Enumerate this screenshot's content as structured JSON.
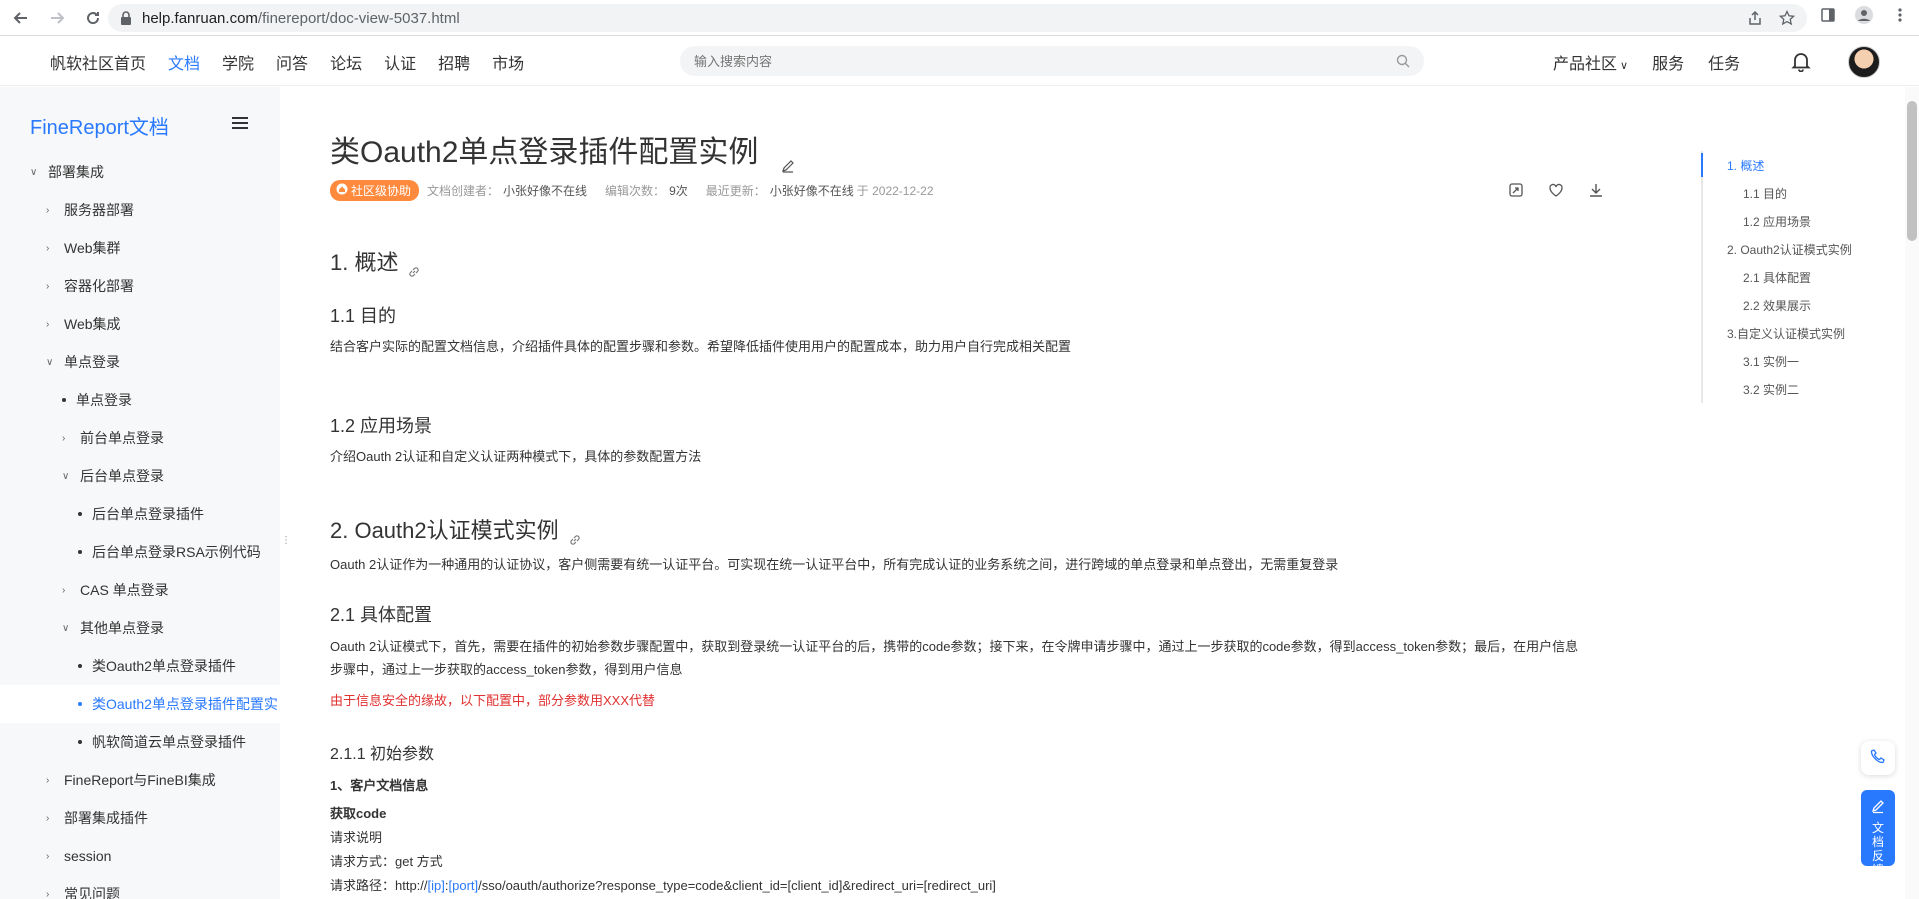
{
  "browser": {
    "url_domain": "help.fanruan.com",
    "url_path": "/finereport/doc-view-5037.html"
  },
  "header": {
    "nav": [
      "帆软社区首页",
      "文档",
      "学院",
      "问答",
      "论坛",
      "认证",
      "招聘",
      "市场"
    ],
    "active_nav": "文档",
    "search_placeholder": "输入搜索内容",
    "right_nav": {
      "product": "产品社区",
      "service": "服务",
      "task": "任务"
    }
  },
  "sidebar": {
    "title": "FineReport文档",
    "items": [
      {
        "label": "部署集成",
        "level": 0,
        "kind": "expanded"
      },
      {
        "label": "服务器部署",
        "level": 1,
        "kind": "collapsed"
      },
      {
        "label": "Web集群",
        "level": 1,
        "kind": "collapsed"
      },
      {
        "label": "容器化部署",
        "level": 1,
        "kind": "collapsed"
      },
      {
        "label": "Web集成",
        "level": 1,
        "kind": "collapsed"
      },
      {
        "label": "单点登录",
        "level": 1,
        "kind": "expanded"
      },
      {
        "label": "单点登录",
        "level": 2,
        "kind": "leaf"
      },
      {
        "label": "前台单点登录",
        "level": 2,
        "kind": "collapsed"
      },
      {
        "label": "后台单点登录",
        "level": 2,
        "kind": "expanded"
      },
      {
        "label": "后台单点登录插件",
        "level": 3,
        "kind": "leaf"
      },
      {
        "label": "后台单点登录RSA示例代码",
        "level": 3,
        "kind": "leaf"
      },
      {
        "label": "CAS 单点登录",
        "level": 2,
        "kind": "collapsed"
      },
      {
        "label": "其他单点登录",
        "level": 2,
        "kind": "expanded"
      },
      {
        "label": "类Oauth2单点登录插件",
        "level": 3,
        "kind": "leaf"
      },
      {
        "label": "类Oauth2单点登录插件配置实",
        "level": 3,
        "kind": "leaf",
        "active": true
      },
      {
        "label": "帆软简道云单点登录插件",
        "level": 3,
        "kind": "leaf"
      },
      {
        "label": "FineReport与FineBI集成",
        "level": 1,
        "kind": "collapsed"
      },
      {
        "label": "部署集成插件",
        "level": 1,
        "kind": "collapsed"
      },
      {
        "label": "session",
        "level": 1,
        "kind": "collapsed"
      },
      {
        "label": "常见问题",
        "level": 1,
        "kind": "collapsed"
      }
    ]
  },
  "doc": {
    "title": "类Oauth2单点登录插件配置实例",
    "badge": "社区级协助",
    "creator_label": "文档创建者：",
    "creator": "小张好像不在线",
    "edits_label": "编辑次数：",
    "edits": "9次",
    "updated_label": "最近更新：",
    "updater": "小张好像不在线",
    "updated_date": "于 2022-12-22",
    "s1": "1. 概述",
    "s1_1": "1.1 目的",
    "s1_1_text": "结合客户实际的配置文档信息，介绍插件具体的配置步骤和参数。希望降低插件使用用户的配置成本，助力用户自行完成相关配置",
    "s1_2": "1.2 应用场景",
    "s1_2_text": "介绍Oauth 2认证和自定义认证两种模式下，具体的参数配置方法",
    "s2": "2. Oauth2认证模式实例",
    "s2_text": "Oauth 2认证作为一种通用的认证协议，客户侧需要有统一认证平台。可实现在统一认证平台中，所有完成认证的业务系统之间，进行跨域的单点登录和单点登出，无需重复登录",
    "s2_1": "2.1 具体配置",
    "s2_1_text": "Oauth 2认证模式下，首先，需要在插件的初始参数步骤配置中，获取到登录统一认证平台的后，携带的code参数；接下来，在令牌申请步骤中，通过上一步获取的code参数，得到access_token参数；最后，在用户信息步骤中，通过上一步获取的access_token参数，得到用户信息",
    "s2_1_warn": "由于信息安全的缘故，以下配置中，部分参数用XXX代替",
    "s2_1_1": "2.1.1 初始参数",
    "customer_info": "1、客户文档信息",
    "get_code": "获取code",
    "req_desc": "请求说明",
    "req_method": "请求方式：get 方式",
    "req_path_prefix": "请求路径：http://",
    "req_path_ip": "[ip]",
    "req_path_colon": ":",
    "req_path_port": "[port]",
    "req_path_suffix": "/sso/oauth/authorize?response_type=code&client_id=[client_id]&redirect_uri=[redirect_uri]"
  },
  "toc": [
    {
      "label": "1. 概述",
      "level": 1,
      "active": true
    },
    {
      "label": "1.1 目的",
      "level": 2
    },
    {
      "label": "1.2 应用场景",
      "level": 2
    },
    {
      "label": "2. Oauth2认证模式实例",
      "level": 1
    },
    {
      "label": "2.1 具体配置",
      "level": 2
    },
    {
      "label": "2.2 效果展示",
      "level": 2
    },
    {
      "label": "3.自定义认证模式实例",
      "level": 1
    },
    {
      "label": "3.1 实例一",
      "level": 2
    },
    {
      "label": "3.2 实例二",
      "level": 2
    }
  ],
  "feedback": {
    "label": "文档反馈"
  },
  "colors": {
    "accent": "#2979ff",
    "badge": "#ff8a3d",
    "warning": "#e03030"
  }
}
